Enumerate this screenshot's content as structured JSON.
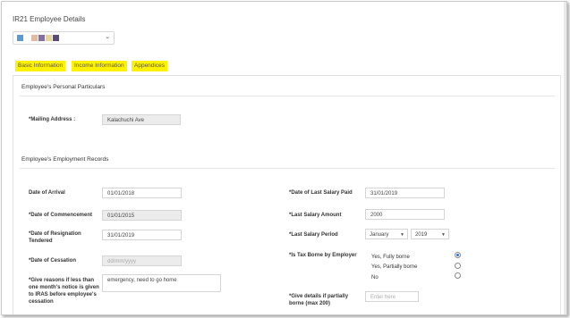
{
  "page": {
    "title": "IR21 Employee Details"
  },
  "picker": {
    "colors": [
      "#5a9bd5",
      "#e6b89c",
      "#8c6b9e",
      "#e8d29a",
      "#5a4a7a"
    ]
  },
  "tabs": [
    {
      "label": "Basic Information"
    },
    {
      "label": "Income Information"
    },
    {
      "label": "Appendices"
    }
  ],
  "personal": {
    "heading": "Employee's Personal Particulars",
    "mailing_label": "*Mailing Address :",
    "mailing_value": "Kalachuchi Ave"
  },
  "employment": {
    "heading": "Employee's Employment Records",
    "arrival_label": "Date of Arrival",
    "arrival_value": "01/01/2018",
    "commencement_label": "*Date of Commencement",
    "commencement_value": "01/01/2015",
    "resignation_label": "*Date of Resignation Tendered",
    "resignation_value": "31/01/2019",
    "cessation_label": "*Date of Cessation",
    "cessation_placeholder": "dd/mm/yyyy",
    "reasons_label": "*Give reasons if less than one month's notice is given to IRAS before employee's cessation",
    "reasons_value": "emergency, need to go home",
    "last_salary_paid_label": "*Date of Last Salary Paid",
    "last_salary_paid_value": "31/01/2019",
    "last_salary_amount_label": "*Last Salary Amount",
    "last_salary_amount_value": "2000",
    "last_salary_period_label": "*Last Salary Period",
    "period_month": "January",
    "period_year": "2019",
    "tax_borne_label": "*Is Tax Borne by Employer",
    "tax_options": [
      "Yes, Fully borne",
      "Yes, Partially borne",
      "No"
    ],
    "tax_selected": 0,
    "partial_details_label": "*Give details if partially borne (max 200)",
    "partial_details_placeholder": "Enter here"
  }
}
